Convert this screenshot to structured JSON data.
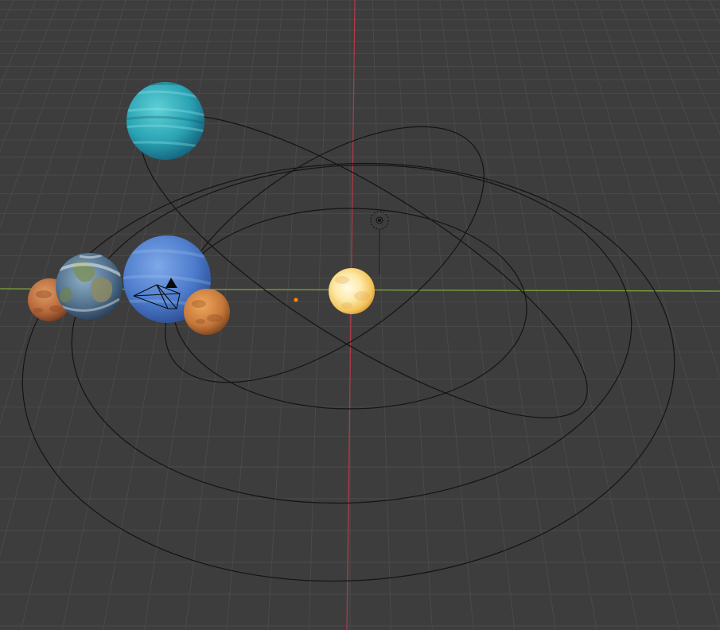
{
  "viewport": {
    "view": "perspective",
    "colors": {
      "background": "#3d3d3d",
      "grid_line": "#4a4a4a",
      "x_axis": "#7fa53a",
      "y_axis": "#b03a47",
      "orbit_curve": "#141414",
      "camera_wire": "#0a0a0a",
      "origin_dot": "#ff8a00"
    },
    "objects": [
      {
        "name": "sun",
        "kind": "sphere",
        "icon": "sun-icon"
      },
      {
        "name": "uranus",
        "kind": "sphere",
        "icon": "uranus-icon"
      },
      {
        "name": "neptune",
        "kind": "sphere",
        "icon": "neptune-icon"
      },
      {
        "name": "earth",
        "kind": "sphere",
        "icon": "earth-icon"
      },
      {
        "name": "mars",
        "kind": "sphere",
        "icon": "mars-icon"
      },
      {
        "name": "venus",
        "kind": "sphere",
        "icon": "venus-icon"
      },
      {
        "name": "camera",
        "kind": "camera",
        "icon": "camera-icon"
      },
      {
        "name": "light",
        "kind": "point-light",
        "icon": "light-icon"
      },
      {
        "name": "origin",
        "kind": "empty",
        "icon": "origin-dot-icon"
      }
    ]
  }
}
